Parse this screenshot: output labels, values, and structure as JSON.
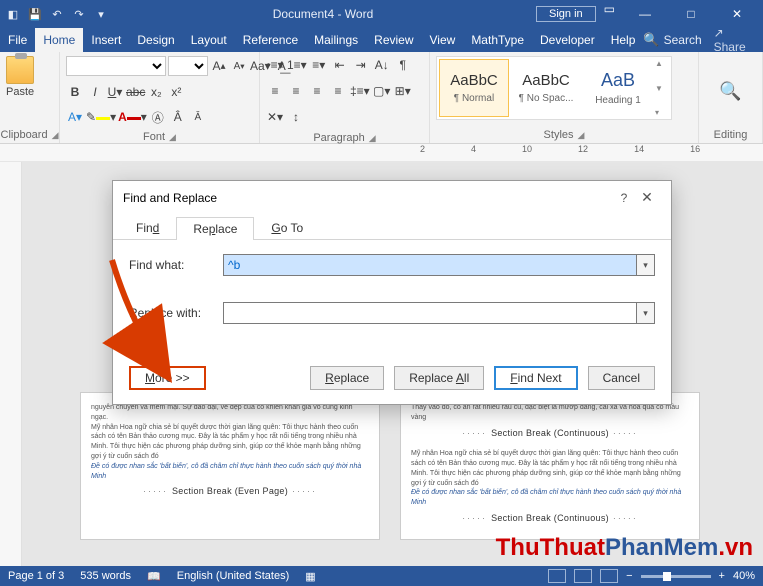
{
  "titlebar": {
    "title": "Document4 - Word",
    "signin": "Sign in"
  },
  "tabs": {
    "file": "File",
    "home": "Home",
    "insert": "Insert",
    "design": "Design",
    "layout": "Layout",
    "references": "Reference",
    "mailings": "Mailings",
    "review": "Review",
    "view": "View",
    "mathtype": "MathType",
    "developer": "Developer",
    "help": "Help",
    "search": "Search",
    "share": "Share"
  },
  "ribbon": {
    "clipboard": {
      "paste": "Paste",
      "label": "Clipboard"
    },
    "font": {
      "label": "Font",
      "sizeUp": "A",
      "sizeDown": "A"
    },
    "paragraph": {
      "label": "Paragraph"
    },
    "styles": {
      "label": "Styles",
      "items": [
        {
          "preview": "AaBbC",
          "name": "¶ Normal"
        },
        {
          "preview": "AaBbC",
          "name": "¶ No Spac..."
        },
        {
          "preview": "AaB",
          "name": "Heading 1"
        }
      ]
    },
    "editing": {
      "label": "Editing"
    }
  },
  "ruler": {
    "marks": [
      "2",
      "4",
      "10",
      "12",
      "14",
      "16"
    ]
  },
  "dialog": {
    "title": "Find and Replace",
    "tabs": {
      "find": "Find",
      "replace": "Replace",
      "goto": "Go To"
    },
    "findLabel": "Find what:",
    "findValue": "^b",
    "replaceLabel": "Replace with:",
    "replaceValue": "",
    "buttons": {
      "more": "More >>",
      "replace": "Replace",
      "replaceAll": "Replace All",
      "findNext": "Find Next",
      "cancel": "Cancel"
    }
  },
  "doc": {
    "sbEven": "Section Break (Even Page)",
    "sbCont": "Section Break (Continuous)",
    "lorem1": "nguyên chuyên và mềm mại. Sự dào dại, vẻ đẹp của cô khiến khán giả vô cùng kinh ngạc.",
    "lorem2": "Mỹ nhân Hoa ngữ chia sẻ bí quyết dược thời gian lãng quên: Tôi thực hành theo cuốn sách có tên Bản thảo cương mục. Đây là tác phẩm y học rất nổi tiếng trong nhiều nhà Minh. Tôi thực hiện các phương pháp dưỡng sinh, giúp cơ thế khỏe mạnh bằng những gợi ý từ cuốn sách đó",
    "lorem3": "Đề có được nhan sắc 'bất biến', cô đã châm chỉ thực hành theo cuốn sách quý thời nhà Minh",
    "lorem4": "Thay vào đó, cô ăn rất nhiều rau củ, đặc biệt là mướp đắng, cải xà và hoa quả có màu vàng",
    "lorem5": "Mỹ nhân Hoa ngữ chia sẻ bí quyết dược thời gian lãng quên: Tôi thực hành theo cuốn sách có tên Bản thảo cương mục. Đây là tác phẩm y học rất nổi tiếng trong nhiều nhà Minh. Tôi thực hiện các phương pháp dưỡng sinh, giúp cơ thế khỏe mạnh bằng những gợi ý từ cuốn sách đó"
  },
  "status": {
    "page": "Page 1 of 3",
    "words": "535 words",
    "lang": "English (United States)",
    "zoom": "40%"
  },
  "watermark": {
    "a": "ThuThuat",
    "b": "PhanMem",
    "c": ".vn"
  }
}
